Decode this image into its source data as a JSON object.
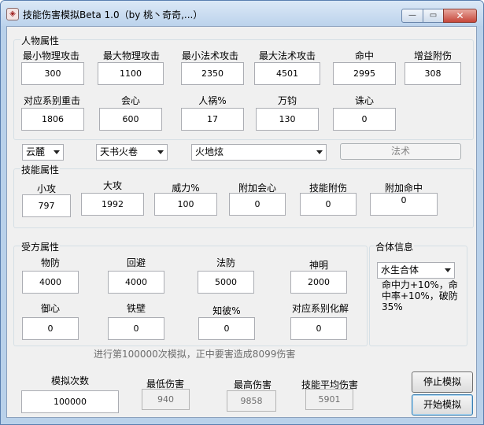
{
  "window": {
    "title": "技能伤害模拟Beta 1.0（by 桃丶奇奇,...）",
    "app_icon_glyph": "◈",
    "buttons": {
      "min": "—",
      "max": "▭",
      "close": "✕"
    }
  },
  "char_group": {
    "title": "人物属性",
    "fields": [
      {
        "label": "最小物理攻击",
        "value": "300"
      },
      {
        "label": "最大物理攻击",
        "value": "1100"
      },
      {
        "label": "最小法术攻击",
        "value": "2350"
      },
      {
        "label": "最大法术攻击",
        "value": "4501"
      },
      {
        "label": "命中",
        "value": "2995"
      },
      {
        "label": "增益附伤",
        "value": "308"
      },
      {
        "label": "对应系别重击",
        "value": "1806"
      },
      {
        "label": "会心",
        "value": "600"
      },
      {
        "label": "人祸%",
        "value": "17"
      },
      {
        "label": "万钧",
        "value": "130"
      },
      {
        "label": "诛心",
        "value": "0"
      }
    ]
  },
  "selectors": {
    "sect": "云麓",
    "book": "天书火卷",
    "skill": "火地炫",
    "skill_type_button": "法术"
  },
  "skill_group": {
    "title": "技能属性",
    "fields": [
      {
        "label": "小攻",
        "value": "797"
      },
      {
        "label": "大攻",
        "value": "1992"
      },
      {
        "label": "威力%",
        "value": "100"
      },
      {
        "label": "附加会心",
        "value": "0"
      },
      {
        "label": "技能附伤",
        "value": "0"
      },
      {
        "label": "附加命中",
        "value": "0"
      }
    ]
  },
  "target_group": {
    "title": "受方属性",
    "fields": [
      {
        "label": "物防",
        "value": "4000"
      },
      {
        "label": "回避",
        "value": "4000"
      },
      {
        "label": "法防",
        "value": "5000"
      },
      {
        "label": "神明",
        "value": "2000"
      },
      {
        "label": "御心",
        "value": "0"
      },
      {
        "label": "铁壁",
        "value": "0"
      },
      {
        "label": "知彼%",
        "value": "0"
      },
      {
        "label": "对应系别化解",
        "value": "0"
      }
    ]
  },
  "combo_group": {
    "title": "合体信息",
    "selected": "水生合体",
    "description": "命中力+10%，命中率+10%，破防35%"
  },
  "status_text": "进行第100000次模拟，正中要害造成8099伤害",
  "sim": {
    "count_label": "模拟次数",
    "count_value": "100000",
    "min_label": "最低伤害",
    "min_value": "940",
    "max_label": "最高伤害",
    "max_value": "9858",
    "avg_label": "技能平均伤害",
    "avg_value": "5901",
    "stop_button": "停止模拟",
    "start_button": "开始模拟"
  }
}
